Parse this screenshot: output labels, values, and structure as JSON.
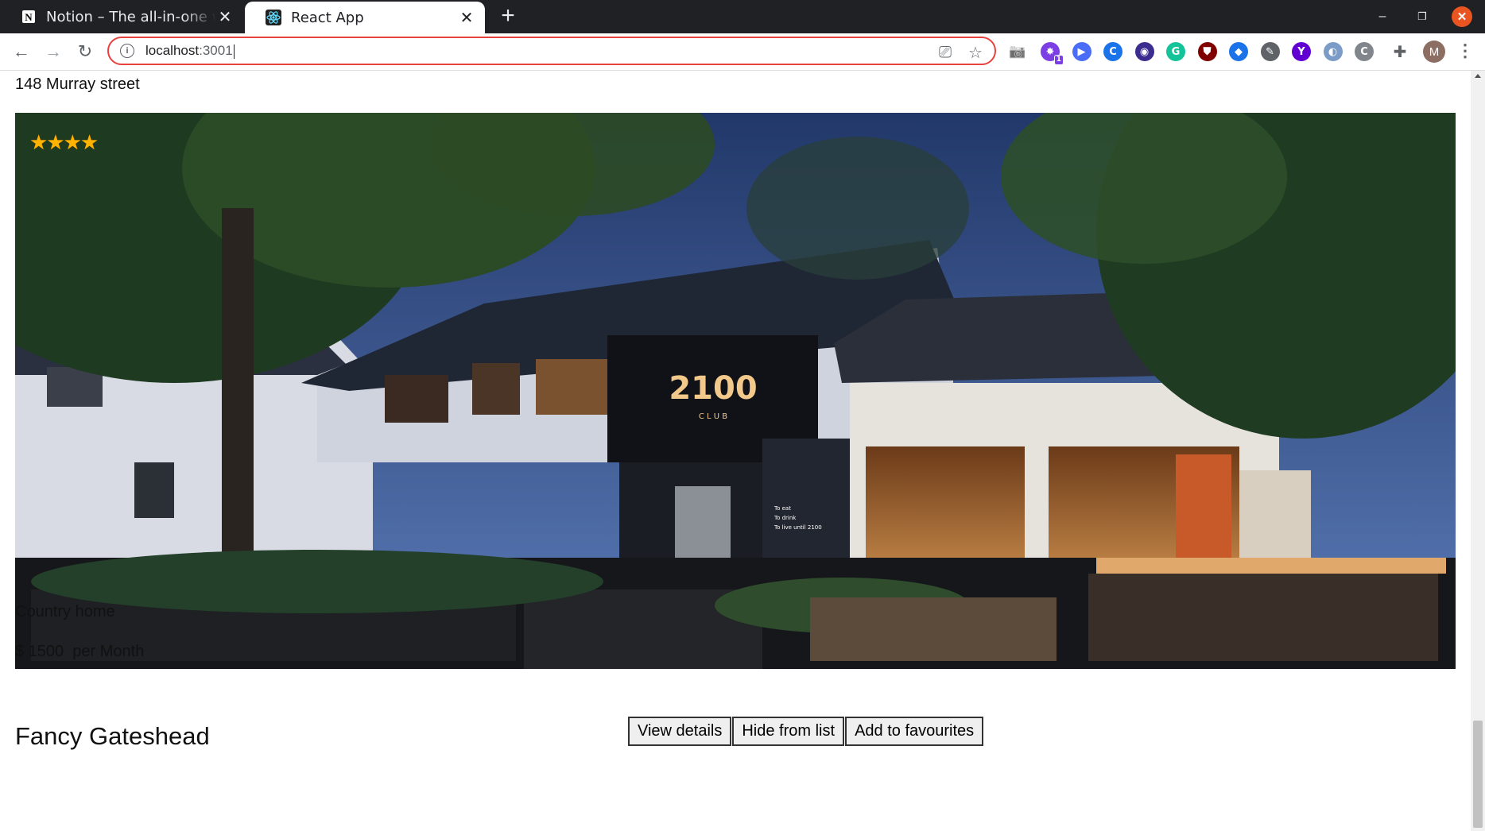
{
  "browser": {
    "tabs": [
      {
        "title": "Notion – The all-in-one workspace",
        "favicon": "notion-icon",
        "active": false
      },
      {
        "title": "React App",
        "favicon": "react-icon",
        "active": true
      }
    ],
    "new_tab": "+",
    "address": {
      "host": "localhost",
      "port": ":3001"
    },
    "window_controls": {
      "minimize": "–",
      "restore": "❐",
      "close": "✕"
    },
    "nav": {
      "back": "←",
      "forward": "→",
      "reload": "↻"
    },
    "info_glyph": "i",
    "omnibox_icons": {
      "cast": "⎚",
      "star": "☆"
    },
    "toolbar_icons": {
      "camera": "📷",
      "extensions": "✚",
      "menu": "⋮"
    },
    "extensions": [
      {
        "name": "ext-purple-burst-icon",
        "color": "#7b3fe4",
        "glyph": "✸",
        "badge": "1"
      },
      {
        "name": "ext-video-icon",
        "color": "#4a6cf7",
        "glyph": "▶"
      },
      {
        "name": "ext-c-icon",
        "color": "#1a73e8",
        "glyph": "C"
      },
      {
        "name": "ext-circle-dark-icon",
        "color": "#3b2d8f",
        "glyph": "◉"
      },
      {
        "name": "ext-grammarly-icon",
        "color": "#15c39a",
        "glyph": "G"
      },
      {
        "name": "ext-ublock-icon",
        "color": "#800000",
        "glyph": "⛊"
      },
      {
        "name": "ext-drop-icon",
        "color": "#1a73e8",
        "glyph": "◆"
      },
      {
        "name": "ext-eyedropper-icon",
        "color": "#5f6368",
        "glyph": "✎"
      },
      {
        "name": "ext-yahoo-icon",
        "color": "#6001d2",
        "glyph": "Y"
      },
      {
        "name": "ext-sphere-icon",
        "color": "#7a9cc6",
        "glyph": "◐"
      },
      {
        "name": "ext-c-bracket-icon",
        "color": "#80868b",
        "glyph": "C"
      }
    ],
    "profile_initial": "M"
  },
  "listing": {
    "address": "148 Murray street",
    "rating_stars": "★★★★",
    "rating": 4,
    "type": "Country home",
    "price": "$ 1500",
    "price_period": "per Month",
    "next_title": "Fancy Gateshead"
  },
  "actions": {
    "view_details": "View details",
    "hide": "Hide from list",
    "favourite": "Add to favourites"
  },
  "photo": {
    "sign_main": "2100",
    "sign_sub": "C L U B",
    "door_sign": [
      "To eat",
      "To drink",
      "To live until 2100"
    ]
  },
  "colors": {
    "accent_focus": "#e8423f",
    "star": "#ffb300"
  }
}
